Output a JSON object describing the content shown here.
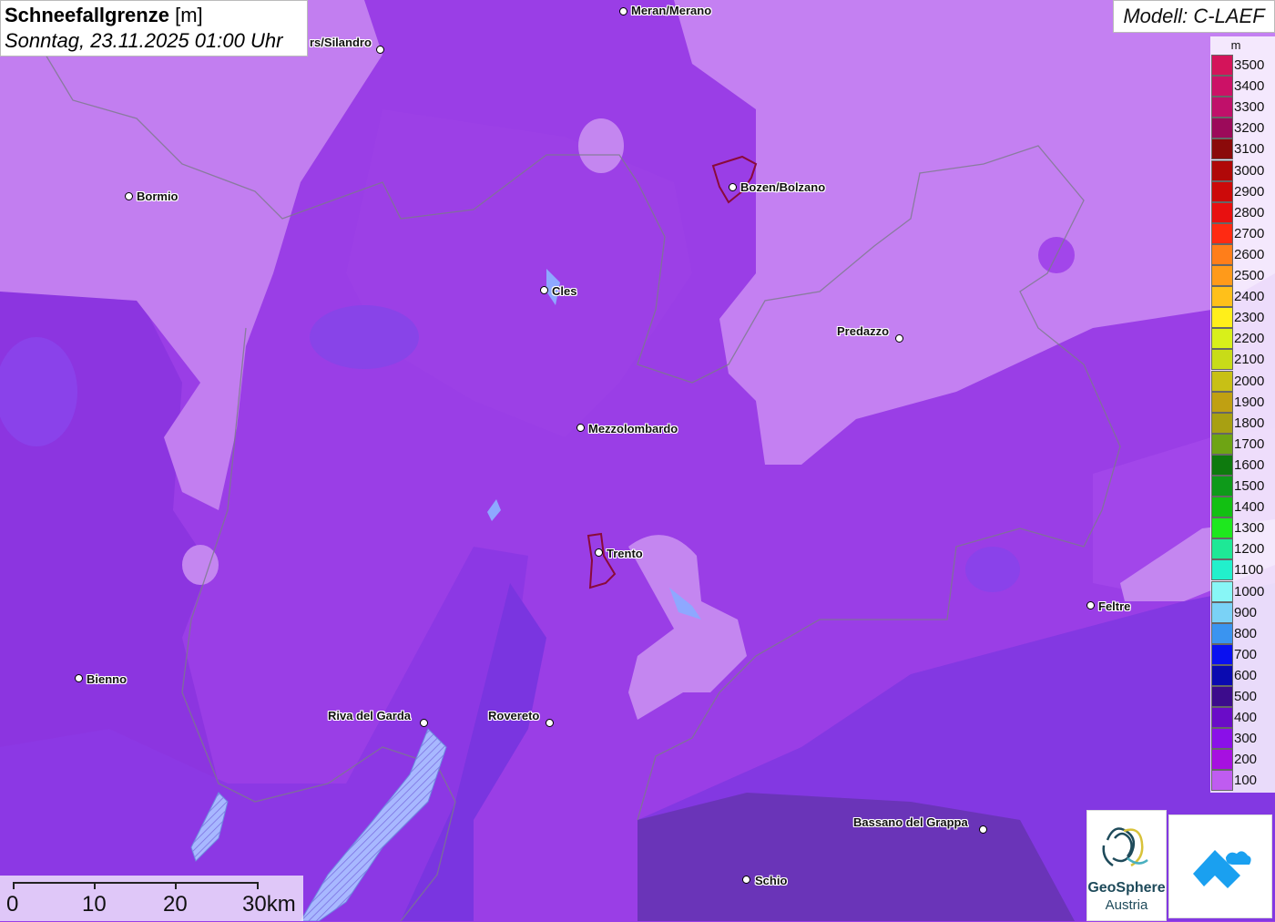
{
  "header": {
    "title_bold": "Schneefallgrenze",
    "title_unit": "[m]",
    "datetime": "Sonntag, 23.11.2025 01:00 Uhr",
    "model": "Modell: C-LAEF"
  },
  "legend": {
    "unit": "m",
    "entries": [
      {
        "label": "3500",
        "color": "#d4145a"
      },
      {
        "label": "3400",
        "color": "#cc1166"
      },
      {
        "label": "3300",
        "color": "#c0106a"
      },
      {
        "label": "3200",
        "color": "#9c0a5a"
      },
      {
        "label": "3100",
        "color": "#8b0a0a"
      },
      {
        "label": "3000",
        "color": "#b00808"
      },
      {
        "label": "2900",
        "color": "#cc0a0a"
      },
      {
        "label": "2800",
        "color": "#e81010"
      },
      {
        "label": "2700",
        "color": "#ff2a12"
      },
      {
        "label": "2600",
        "color": "#ff7e1a"
      },
      {
        "label": "2500",
        "color": "#ff9a1a"
      },
      {
        "label": "2400",
        "color": "#ffc01a"
      },
      {
        "label": "2300",
        "color": "#ffef1a"
      },
      {
        "label": "2200",
        "color": "#d8f01a"
      },
      {
        "label": "2100",
        "color": "#c8dc18"
      },
      {
        "label": "2000",
        "color": "#c8c015"
      },
      {
        "label": "1900",
        "color": "#c0a012"
      },
      {
        "label": "1800",
        "color": "#a8a012"
      },
      {
        "label": "1700",
        "color": "#6ea414"
      },
      {
        "label": "1600",
        "color": "#0e7a0e"
      },
      {
        "label": "1500",
        "color": "#0e9a1a"
      },
      {
        "label": "1400",
        "color": "#12c012"
      },
      {
        "label": "1300",
        "color": "#1ee81e"
      },
      {
        "label": "1200",
        "color": "#1ee896"
      },
      {
        "label": "1100",
        "color": "#22f0cc"
      },
      {
        "label": "1000",
        "color": "#88f6f6"
      },
      {
        "label": "900",
        "color": "#7ad2f6"
      },
      {
        "label": "800",
        "color": "#3a94f0"
      },
      {
        "label": "700",
        "color": "#0a10f0"
      },
      {
        "label": "600",
        "color": "#0a0ab0"
      },
      {
        "label": "500",
        "color": "#3c0c8c"
      },
      {
        "label": "400",
        "color": "#6a0cc8"
      },
      {
        "label": "300",
        "color": "#8a10e8"
      },
      {
        "label": "200",
        "color": "#a610e0"
      },
      {
        "label": "100",
        "color": "#bf5cf0"
      }
    ]
  },
  "cities": [
    {
      "name": "Meran/Merano"
    },
    {
      "name": "rs/Silandro"
    },
    {
      "name": "Bormio"
    },
    {
      "name": "Bozen/Bolzano"
    },
    {
      "name": "Cles"
    },
    {
      "name": "Predazzo"
    },
    {
      "name": "Mezzolombardo"
    },
    {
      "name": "Trento"
    },
    {
      "name": "Feltre"
    },
    {
      "name": "Bienno"
    },
    {
      "name": "Riva del Garda"
    },
    {
      "name": "Rovereto"
    },
    {
      "name": "Bassano del Grappa"
    },
    {
      "name": "Schio"
    }
  ],
  "scale": {
    "labels": [
      "0",
      "10",
      "20",
      "30km"
    ]
  },
  "logos": {
    "geosphere_line1": "GeoSphere",
    "geosphere_line2": "Austria"
  }
}
